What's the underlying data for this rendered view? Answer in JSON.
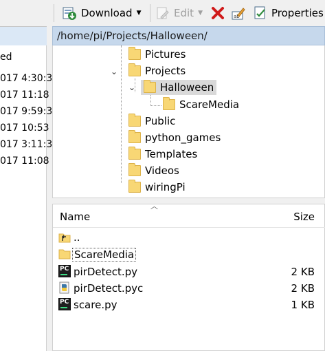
{
  "toolbar": {
    "download_label": "Download",
    "edit_label": "Edit",
    "properties_label": "Properties"
  },
  "left_panel": {
    "header_fragment": "ed",
    "rows": [
      "017  4:30:3",
      "017  11:18",
      "017  9:59:3",
      "017  10:53",
      "017  3:11:3",
      "017  11:08"
    ]
  },
  "path": "/home/pi/Projects/Halloween/",
  "tree": {
    "items": [
      {
        "label": "Pictures"
      },
      {
        "label": "Projects"
      },
      {
        "label": "Halloween"
      },
      {
        "label": "ScareMedia"
      },
      {
        "label": "Public"
      },
      {
        "label": "python_games"
      },
      {
        "label": "Templates"
      },
      {
        "label": "Videos"
      },
      {
        "label": "wiringPi"
      }
    ]
  },
  "file_list": {
    "columns": {
      "name": "Name",
      "size": "Size"
    },
    "rows": [
      {
        "name": "..",
        "size": "",
        "icon": "parent-folder-icon"
      },
      {
        "name": "ScareMedia",
        "size": "",
        "icon": "folder-icon"
      },
      {
        "name": "pirDetect.py",
        "size": "2 KB",
        "icon": "pycharm-file-icon"
      },
      {
        "name": "pirDetect.pyc",
        "size": "2 KB",
        "icon": "python-compiled-icon"
      },
      {
        "name": "scare.py",
        "size": "1 KB",
        "icon": "pycharm-file-icon"
      }
    ]
  }
}
